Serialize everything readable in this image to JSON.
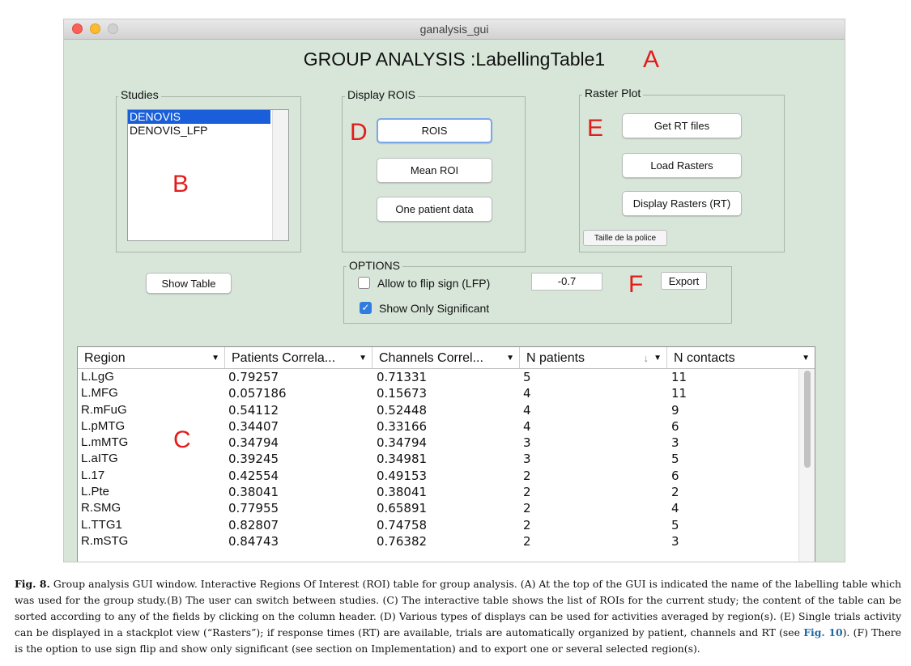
{
  "window": {
    "title": "ganalysis_gui"
  },
  "heading": "GROUP ANALYSIS :LabellingTable1",
  "markers": {
    "A": "A",
    "B": "B",
    "C": "C",
    "D": "D",
    "E": "E",
    "F": "F"
  },
  "studies": {
    "title": "Studies",
    "items": [
      {
        "label": "DENOVIS"
      },
      {
        "label": "DENOVIS_LFP"
      }
    ],
    "selected_index": 0
  },
  "display_rois": {
    "title": "Display ROIS",
    "buttons": {
      "rois": "ROIS",
      "mean_roi": "Mean ROI",
      "one_patient": "One patient data"
    }
  },
  "raster_plot": {
    "title": "Raster Plot",
    "buttons": {
      "get_rt": "Get RT files",
      "load_rasters": "Load Rasters",
      "display_rasters": "Display Rasters (RT)",
      "font_size": "Taille de la police"
    }
  },
  "show_table_label": "Show Table",
  "options": {
    "title": "OPTIONS",
    "flip_sign_label": "Allow to flip sign (LFP)",
    "flip_sign_checked": false,
    "show_significant_label": "Show Only Significant",
    "show_significant_checked": true,
    "threshold_value": "-0.7",
    "export_label": "Export"
  },
  "table": {
    "columns": [
      "Region",
      "Patients Correla...",
      "Channels Correl...",
      "N patients",
      "N contacts"
    ],
    "sorted_column": "N patients",
    "rows": [
      [
        "L.LgG",
        "0.79257",
        "0.71331",
        "5",
        "11"
      ],
      [
        "L.MFG",
        "0.057186",
        "0.15673",
        "4",
        "11"
      ],
      [
        "R.mFuG",
        "0.54112",
        "0.52448",
        "4",
        "9"
      ],
      [
        "L.pMTG",
        "0.34407",
        "0.33166",
        "4",
        "6"
      ],
      [
        "L.mMTG",
        "0.34794",
        "0.34794",
        "3",
        "3"
      ],
      [
        "L.aITG",
        "0.39245",
        "0.34981",
        "3",
        "5"
      ],
      [
        "L.17",
        "0.42554",
        "0.49153",
        "2",
        "6"
      ],
      [
        "L.Pte",
        "0.38041",
        "0.38041",
        "2",
        "2"
      ],
      [
        "R.SMG",
        "0.77955",
        "0.65891",
        "2",
        "4"
      ],
      [
        "L.TTG1",
        "0.82807",
        "0.74758",
        "2",
        "5"
      ],
      [
        "R.mSTG",
        "0.84743",
        "0.76382",
        "2",
        "3"
      ]
    ]
  },
  "caption": {
    "label": "Fig. 8.",
    "text_1": "Group analysis GUI window. Interactive Regions Of Interest (ROI) table for group analysis. (A) At the top of the GUI is indicated the name of the labelling table which was used for the group study.(B) The user can switch between studies. (C) The interactive table shows the list of ROIs for the current study; the content of the table can be sorted according to any of the fields by clicking on the column header. (D) Various types of displays can be used for activities averaged by region(s). (E) Single trials activity can be displayed in a stackplot view (“Rasters”); if response times (RT) are available, trials are automatically organized by patient, channels and RT (see ",
    "fig_ref": "Fig. 10",
    "text_2": "). (F) There is the option to use sign flip and show only significant (see section on Implementation) and to export one or several selected region(s)."
  }
}
